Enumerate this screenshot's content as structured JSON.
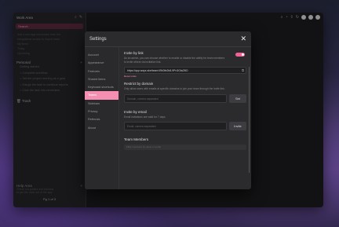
{
  "sidebar": {
    "workspace": "Work Area",
    "search_label": "Search",
    "faded_lines": [
      "Add a new app connection from the",
      "Integrations section to import tasks",
      "My items",
      "Today",
      "Upcoming"
    ],
    "personal": "Personal",
    "personal_group": "Getting started",
    "tasks": [
      "Complete workflow",
      "Set the project running as a goal",
      "Gauge the task to continue reports",
      "Click the task into reminders"
    ],
    "trash": "Trash",
    "footer_title": "Help Area",
    "footer_lines": [
      "Check our guides and tutorials",
      "to get the most out of the app"
    ],
    "pager": "Pg 1 of 3"
  },
  "modal": {
    "title": "Settings",
    "nav": [
      "Account",
      "Appearance",
      "Features",
      "Shared items",
      "Keyboard shortcuts",
      "Teams",
      "Sidebars",
      "Privacy",
      "Referrals",
      "About"
    ],
    "active_nav": "Teams",
    "invite_title": "Invite by link",
    "invite_desc": "As an admin, you can choose whether to enable or disable the ability for team members to invite others via invitation link.",
    "invite_url": "https://app.ways.ske/team/49b3fe2b8-9Pn3Gfa2BO",
    "reset_link": "Reset Links",
    "domain_title": "Restrict by domain",
    "domain_desc": "Only allow users with emails at specific domains to join your team through the invite link.",
    "domain_placeholder": "Domain, comma separated",
    "set_button": "Set",
    "email_title": "Invite by email",
    "email_desc": "Email invitations are valid for 7 days",
    "email_placeholder": "Email, comma separated",
    "invite_button": "Invite",
    "members_title": "Team Members",
    "members_placeholder": "Filter members by name or email"
  },
  "colors": {
    "accent": "#f48fb1",
    "toggle_on": "#f06292"
  }
}
